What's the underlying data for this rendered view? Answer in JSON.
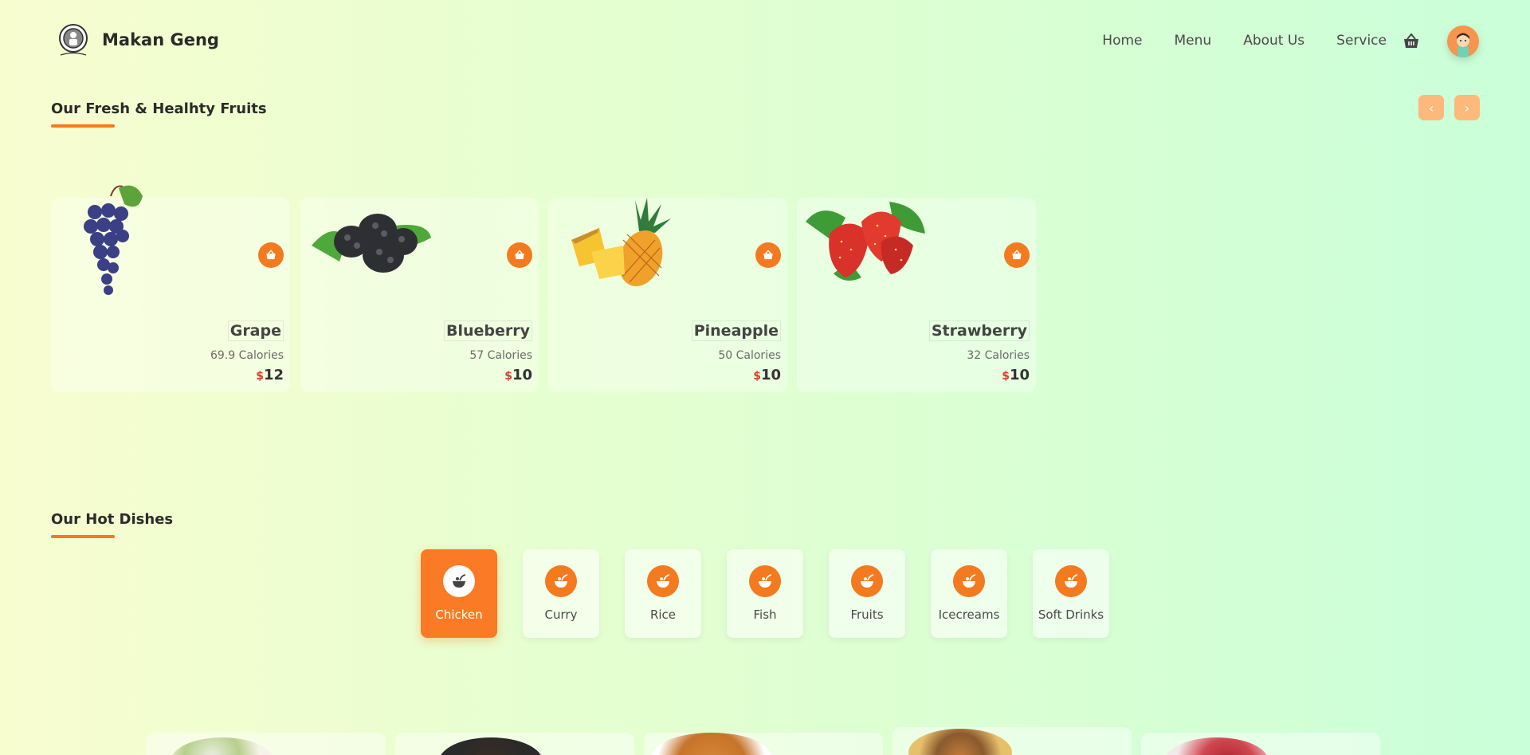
{
  "brand": {
    "name": "Makan Geng",
    "logo_icon": "chef-logo-icon"
  },
  "nav": {
    "items": [
      "Home",
      "Menu",
      "About Us",
      "Service"
    ],
    "cart_icon": "basket-icon",
    "avatar_icon": "user-avatar-icon"
  },
  "fruits": {
    "title": "Our Fresh & Healhty Fruits",
    "prev_label": "‹",
    "next_label": "›",
    "items": [
      {
        "name": "Grape",
        "calories": "69.9 Calories",
        "currency": "$",
        "price": "12"
      },
      {
        "name": "Blueberry",
        "calories": "57 Calories",
        "currency": "$",
        "price": "10"
      },
      {
        "name": "Pineapple",
        "calories": "50 Calories",
        "currency": "$",
        "price": "10"
      },
      {
        "name": "Strawberry",
        "calories": "32 Calories",
        "currency": "$",
        "price": "10"
      }
    ]
  },
  "dishes": {
    "title": "Our Hot Dishes",
    "categories": [
      "Chicken",
      "Curry",
      "Rice",
      "Fish",
      "Fruits",
      "Icecreams",
      "Soft Drinks"
    ],
    "active_category": "Chicken"
  },
  "colors": {
    "accent": "#f47a1f",
    "active_bg": "#fa7a25",
    "price_currency": "#e23b2a",
    "arrow_bg": "#fdb97c"
  }
}
